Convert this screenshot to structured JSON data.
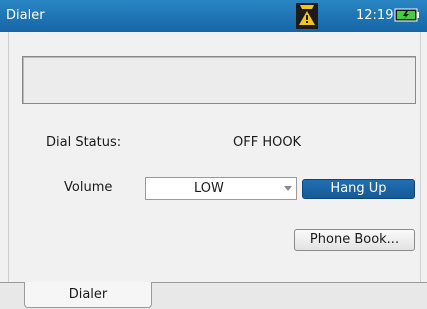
{
  "titlebar": {
    "title": "Dialer",
    "time": "12:19",
    "icons": [
      "warning-icon",
      "battery-icon"
    ],
    "accent_color": "#1565a5"
  },
  "main": {
    "display_text": "",
    "dial_status_label": "Dial Status:",
    "dial_status_value": "OFF HOOK",
    "volume_label": "Volume",
    "volume_value": "LOW",
    "hangup_label": "Hang Up",
    "phonebook_label": "Phone Book..."
  },
  "tabs": [
    {
      "label": "Dialer",
      "selected": true
    }
  ]
}
